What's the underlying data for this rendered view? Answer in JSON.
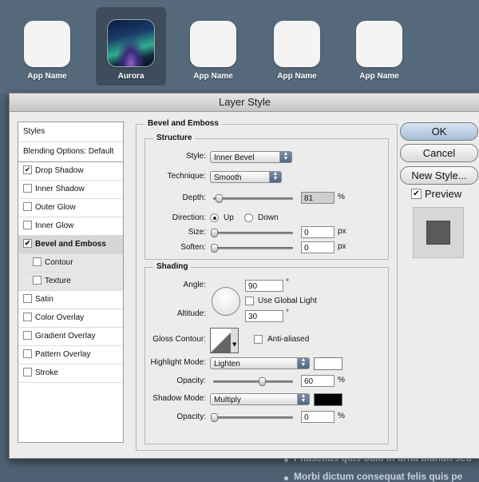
{
  "apps": [
    {
      "label": "App Name",
      "selected": false
    },
    {
      "label": "Aurora",
      "selected": true
    },
    {
      "label": "App Name",
      "selected": false
    },
    {
      "label": "App Name",
      "selected": false
    },
    {
      "label": "App Name",
      "selected": false
    }
  ],
  "background_text": {
    "line1": "Phasellus quis odio in urna blandit sed",
    "line2": "Morbi dictum consequat felis quis pe"
  },
  "dialog": {
    "title": "Layer Style"
  },
  "styles_list": {
    "header": "Styles",
    "blending": "Blending Options: Default",
    "items": [
      {
        "label": "Drop Shadow",
        "checked": true,
        "mark": "✔"
      },
      {
        "label": "Inner Shadow",
        "checked": false,
        "mark": ""
      },
      {
        "label": "Outer Glow",
        "checked": false,
        "mark": ""
      },
      {
        "label": "Inner Glow",
        "checked": false,
        "mark": ""
      },
      {
        "label": "Bevel and Emboss",
        "checked": true,
        "mark": "✔"
      },
      {
        "label": "Contour",
        "checked": false,
        "mark": ""
      },
      {
        "label": "Texture",
        "checked": false,
        "mark": ""
      },
      {
        "label": "Satin",
        "checked": false,
        "mark": ""
      },
      {
        "label": "Color Overlay",
        "checked": false,
        "mark": ""
      },
      {
        "label": "Gradient Overlay",
        "checked": false,
        "mark": ""
      },
      {
        "label": "Pattern Overlay",
        "checked": false,
        "mark": ""
      },
      {
        "label": "Stroke",
        "checked": false,
        "mark": ""
      }
    ]
  },
  "bevel": {
    "title": "Bevel and Emboss",
    "structure": {
      "title": "Structure",
      "style_label": "Style:",
      "style_value": "Inner Bevel",
      "technique_label": "Technique:",
      "technique_value": "Smooth",
      "depth_label": "Depth:",
      "depth_value": "81",
      "depth_unit": "%",
      "direction_label": "Direction:",
      "direction_up": "Up",
      "direction_down": "Down",
      "size_label": "Size:",
      "size_value": "0",
      "size_unit": "px",
      "soften_label": "Soften:",
      "soften_value": "0",
      "soften_unit": "px"
    },
    "shading": {
      "title": "Shading",
      "angle_label": "Angle:",
      "angle_value": "90",
      "angle_unit": "°",
      "global_light_label": "Use Global Light",
      "altitude_label": "Altitude:",
      "altitude_value": "30",
      "altitude_unit": "°",
      "gloss_label": "Gloss Contour:",
      "anti_aliased_label": "Anti-aliased",
      "highlight_label": "Highlight Mode:",
      "highlight_value": "Lighten",
      "highlight_color": "#ffffff",
      "opacity1_label": "Opacity:",
      "opacity1_value": "60",
      "opacity1_unit": "%",
      "shadow_label": "Shadow Mode:",
      "shadow_value": "Multiply",
      "shadow_color": "#000000",
      "opacity2_label": "Opacity:",
      "opacity2_value": "0",
      "opacity2_unit": "%"
    }
  },
  "buttons": {
    "ok": "OK",
    "cancel": "Cancel",
    "new_style": "New Style...",
    "preview": "Preview",
    "preview_mark": "✔"
  },
  "colors": {
    "accent": "#4e6784",
    "preview_swatch": "#5a5a5a"
  }
}
